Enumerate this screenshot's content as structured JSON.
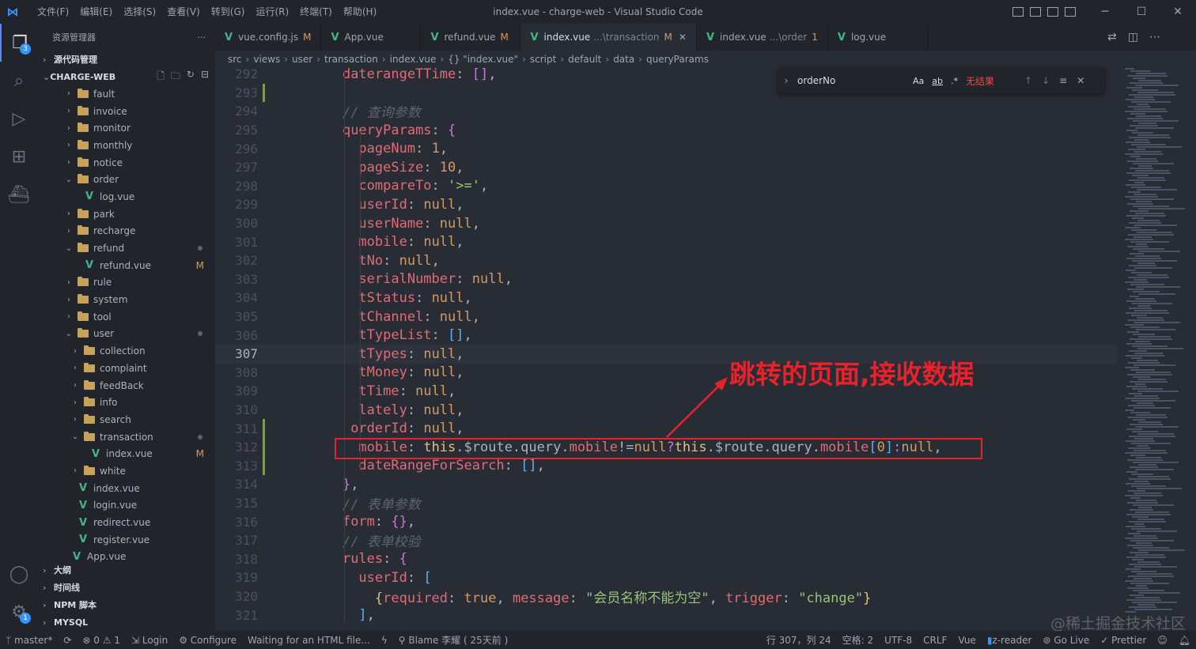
{
  "window": {
    "title": "index.vue - charge-web - Visual Studio Code",
    "menu": [
      "文件(F)",
      "编辑(E)",
      "选择(S)",
      "查看(V)",
      "转到(G)",
      "运行(R)",
      "终端(T)",
      "帮助(H)"
    ],
    "controls": {
      "minimize": "─",
      "maximize": "☐",
      "close": "✕"
    }
  },
  "activity": {
    "explorer_badge": "3",
    "settings_badge": "1"
  },
  "sidebar": {
    "header": "资源管理器",
    "header_more": "···",
    "scm_section": "源代码管理",
    "project": "CHARGE-WEB",
    "tree": [
      {
        "label": "fault",
        "type": "folder",
        "depth": 1,
        "state": "collapsed"
      },
      {
        "label": "invoice",
        "type": "folder",
        "depth": 1,
        "state": "collapsed"
      },
      {
        "label": "monitor",
        "type": "folder",
        "depth": 1,
        "state": "collapsed"
      },
      {
        "label": "monthly",
        "type": "folder",
        "depth": 1,
        "state": "collapsed"
      },
      {
        "label": "notice",
        "type": "folder",
        "depth": 1,
        "state": "collapsed"
      },
      {
        "label": "order",
        "type": "folder",
        "depth": 1,
        "state": "expanded"
      },
      {
        "label": "log.vue",
        "type": "vue",
        "depth": 2
      },
      {
        "label": "park",
        "type": "folder",
        "depth": 1,
        "state": "collapsed"
      },
      {
        "label": "recharge",
        "type": "folder",
        "depth": 1,
        "state": "collapsed"
      },
      {
        "label": "refund",
        "type": "folder",
        "depth": 1,
        "state": "expanded",
        "dot": true
      },
      {
        "label": "refund.vue",
        "type": "vue",
        "depth": 2,
        "status": "M"
      },
      {
        "label": "rule",
        "type": "folder",
        "depth": 1,
        "state": "collapsed"
      },
      {
        "label": "system",
        "type": "folder",
        "depth": 1,
        "state": "collapsed"
      },
      {
        "label": "tool",
        "type": "folder",
        "depth": 1,
        "state": "collapsed"
      },
      {
        "label": "user",
        "type": "folder",
        "depth": 1,
        "state": "expanded",
        "dot": true
      },
      {
        "label": "collection",
        "type": "folder",
        "depth": 2,
        "state": "collapsed"
      },
      {
        "label": "complaint",
        "type": "folder",
        "depth": 2,
        "state": "collapsed"
      },
      {
        "label": "feedBack",
        "type": "folder",
        "depth": 2,
        "state": "collapsed"
      },
      {
        "label": "info",
        "type": "folder",
        "depth": 2,
        "state": "collapsed"
      },
      {
        "label": "search",
        "type": "folder",
        "depth": 2,
        "state": "collapsed"
      },
      {
        "label": "transaction",
        "type": "folder",
        "depth": 2,
        "state": "expanded",
        "dot": true
      },
      {
        "label": "index.vue",
        "type": "vue",
        "depth": 3,
        "status": "M"
      },
      {
        "label": "white",
        "type": "folder",
        "depth": 2,
        "state": "collapsed"
      },
      {
        "label": "index.vue",
        "type": "vue",
        "depth": 1
      },
      {
        "label": "login.vue",
        "type": "vue",
        "depth": 1
      },
      {
        "label": "redirect.vue",
        "type": "vue",
        "depth": 1
      },
      {
        "label": "register.vue",
        "type": "vue",
        "depth": 1
      },
      {
        "label": "App.vue",
        "type": "vue",
        "depth": 0
      }
    ],
    "bottom_sections": [
      "大纲",
      "时间线",
      "NPM 脚本",
      "MYSQL"
    ]
  },
  "tabs": [
    {
      "name": "vue.config.js",
      "status": "M",
      "icon": "vue-icon"
    },
    {
      "name": "App.vue",
      "status": "",
      "icon": "vue-icon"
    },
    {
      "name": "refund.vue",
      "status": "M",
      "icon": "vue-icon"
    },
    {
      "name": "index.vue",
      "desc": "...\\transaction",
      "status": "M",
      "icon": "vue-icon",
      "active": true,
      "close": "✕"
    },
    {
      "name": "index.vue",
      "desc": "...\\order",
      "status": "1",
      "icon": "vue-icon"
    },
    {
      "name": "log.vue",
      "status": "",
      "icon": "vue-icon"
    }
  ],
  "breadcrumb": [
    "src",
    "views",
    "user",
    "transaction",
    "index.vue",
    "{} \"index.vue\"",
    "script",
    "default",
    "data",
    "queryParams"
  ],
  "find": {
    "value": "orderNo",
    "match_case": "Aa",
    "whole_word": "ab",
    "regex": ".*",
    "result": "无结果"
  },
  "editor": {
    "current_line": 307,
    "lines": [
      {
        "n": 292,
        "tokens": [
          [
            "    ",
            ""
          ],
          [
            "daterangeTTime",
            "prop"
          ],
          [
            ": ",
            "pun"
          ],
          [
            "[]",
            "brk2"
          ],
          [
            ",",
            "pun"
          ]
        ]
      },
      {
        "n": 293,
        "tokens": []
      },
      {
        "n": 294,
        "tokens": [
          [
            "    ",
            ""
          ],
          [
            "// 查询参数",
            "com"
          ]
        ]
      },
      {
        "n": 295,
        "tokens": [
          [
            "    ",
            ""
          ],
          [
            "queryParams",
            "prop"
          ],
          [
            ": ",
            "pun"
          ],
          [
            "{",
            "brk2"
          ]
        ]
      },
      {
        "n": 296,
        "tokens": [
          [
            "      ",
            ""
          ],
          [
            "pageNum",
            "prop"
          ],
          [
            ": ",
            "pun"
          ],
          [
            "1",
            "num"
          ],
          [
            ",",
            "pun"
          ]
        ]
      },
      {
        "n": 297,
        "tokens": [
          [
            "      ",
            ""
          ],
          [
            "pageSize",
            "prop"
          ],
          [
            ": ",
            "pun"
          ],
          [
            "10",
            "num"
          ],
          [
            ",",
            "pun"
          ]
        ]
      },
      {
        "n": 298,
        "tokens": [
          [
            "      ",
            ""
          ],
          [
            "compareTo",
            "prop"
          ],
          [
            ": ",
            "pun"
          ],
          [
            "'>='",
            "str"
          ],
          [
            ",",
            "pun"
          ]
        ]
      },
      {
        "n": 299,
        "tokens": [
          [
            "      ",
            ""
          ],
          [
            "userId",
            "prop"
          ],
          [
            ": ",
            "pun"
          ],
          [
            "null",
            "num"
          ],
          [
            ",",
            "pun"
          ]
        ]
      },
      {
        "n": 300,
        "tokens": [
          [
            "      ",
            ""
          ],
          [
            "userName",
            "prop"
          ],
          [
            ": ",
            "pun"
          ],
          [
            "null",
            "num"
          ],
          [
            ",",
            "pun"
          ]
        ]
      },
      {
        "n": 301,
        "tokens": [
          [
            "      ",
            ""
          ],
          [
            "mobile",
            "prop"
          ],
          [
            ": ",
            "pun"
          ],
          [
            "null",
            "num"
          ],
          [
            ",",
            "pun"
          ]
        ]
      },
      {
        "n": 302,
        "tokens": [
          [
            "      ",
            ""
          ],
          [
            "tNo",
            "prop"
          ],
          [
            ": ",
            "pun"
          ],
          [
            "null",
            "num"
          ],
          [
            ",",
            "pun"
          ]
        ]
      },
      {
        "n": 303,
        "tokens": [
          [
            "      ",
            ""
          ],
          [
            "serialNumber",
            "prop"
          ],
          [
            ": ",
            "pun"
          ],
          [
            "null",
            "num"
          ],
          [
            ",",
            "pun"
          ]
        ]
      },
      {
        "n": 304,
        "tokens": [
          [
            "      ",
            ""
          ],
          [
            "tStatus",
            "prop"
          ],
          [
            ": ",
            "pun"
          ],
          [
            "null",
            "num"
          ],
          [
            ",",
            "pun"
          ]
        ]
      },
      {
        "n": 305,
        "tokens": [
          [
            "      ",
            ""
          ],
          [
            "tChannel",
            "prop"
          ],
          [
            ": ",
            "pun"
          ],
          [
            "null",
            "num"
          ],
          [
            ",",
            "pun"
          ]
        ]
      },
      {
        "n": 306,
        "tokens": [
          [
            "      ",
            ""
          ],
          [
            "tTypeList",
            "prop"
          ],
          [
            ": ",
            "pun"
          ],
          [
            "[]",
            "brk3"
          ],
          [
            ",",
            "pun"
          ]
        ]
      },
      {
        "n": 307,
        "tokens": [
          [
            "      ",
            ""
          ],
          [
            "tTypes",
            "prop"
          ],
          [
            ": ",
            "pun"
          ],
          [
            "null",
            "num"
          ],
          [
            ",",
            "pun"
          ]
        ]
      },
      {
        "n": 308,
        "tokens": [
          [
            "      ",
            ""
          ],
          [
            "tMoney",
            "prop"
          ],
          [
            ": ",
            "pun"
          ],
          [
            "null",
            "num"
          ],
          [
            ",",
            "pun"
          ]
        ]
      },
      {
        "n": 309,
        "tokens": [
          [
            "      ",
            ""
          ],
          [
            "tTime",
            "prop"
          ],
          [
            ": ",
            "pun"
          ],
          [
            "null",
            "num"
          ],
          [
            ",",
            "pun"
          ]
        ]
      },
      {
        "n": 310,
        "tokens": [
          [
            "      ",
            ""
          ],
          [
            "lately",
            "prop"
          ],
          [
            ": ",
            "pun"
          ],
          [
            "null",
            "num"
          ],
          [
            ",",
            "pun"
          ]
        ]
      },
      {
        "n": 311,
        "tokens": [
          [
            "     ",
            ""
          ],
          [
            "orderId",
            "prop"
          ],
          [
            ": ",
            "pun"
          ],
          [
            "null",
            "num"
          ],
          [
            ",",
            "pun"
          ]
        ]
      },
      {
        "n": 312,
        "tokens": [
          [
            "      ",
            ""
          ],
          [
            "mobile",
            "prop"
          ],
          [
            ": ",
            "pun"
          ],
          [
            "this",
            "this"
          ],
          [
            ".$route.query.",
            "pun"
          ],
          [
            "mobile",
            "prop"
          ],
          [
            "!=",
            "pun"
          ],
          [
            "null",
            "num"
          ],
          [
            "?",
            "kw"
          ],
          [
            "this",
            "this"
          ],
          [
            ".$route.query.",
            "pun"
          ],
          [
            "mobile",
            "prop"
          ],
          [
            "[",
            "brk3"
          ],
          [
            "0",
            "num"
          ],
          [
            "]",
            "brk3"
          ],
          [
            ":",
            "kw"
          ],
          [
            "null",
            "num"
          ],
          [
            ",",
            "pun"
          ]
        ]
      },
      {
        "n": 313,
        "tokens": [
          [
            "      ",
            ""
          ],
          [
            "dateRangeForSearch",
            "prop"
          ],
          [
            ": ",
            "pun"
          ],
          [
            "[]",
            "brk3"
          ],
          [
            ",",
            "pun"
          ]
        ]
      },
      {
        "n": 314,
        "tokens": [
          [
            "    ",
            ""
          ],
          [
            "}",
            "brk2"
          ],
          [
            ",",
            "pun"
          ]
        ]
      },
      {
        "n": 315,
        "tokens": [
          [
            "    ",
            ""
          ],
          [
            "// 表单参数",
            "com"
          ]
        ]
      },
      {
        "n": 316,
        "tokens": [
          [
            "    ",
            ""
          ],
          [
            "form",
            "prop"
          ],
          [
            ": ",
            "pun"
          ],
          [
            "{}",
            "brk2"
          ],
          [
            ",",
            "pun"
          ]
        ]
      },
      {
        "n": 317,
        "tokens": [
          [
            "    ",
            ""
          ],
          [
            "// 表单校验",
            "com"
          ]
        ]
      },
      {
        "n": 318,
        "tokens": [
          [
            "    ",
            ""
          ],
          [
            "rules",
            "prop"
          ],
          [
            ": ",
            "pun"
          ],
          [
            "{",
            "brk2"
          ]
        ]
      },
      {
        "n": 319,
        "tokens": [
          [
            "      ",
            ""
          ],
          [
            "userId",
            "prop"
          ],
          [
            ": ",
            "pun"
          ],
          [
            "[",
            "brk3"
          ]
        ]
      },
      {
        "n": 320,
        "tokens": [
          [
            "        ",
            ""
          ],
          [
            "{",
            "brk"
          ],
          [
            "required",
            "prop"
          ],
          [
            ": ",
            "pun"
          ],
          [
            "true",
            "num"
          ],
          [
            ", ",
            "pun"
          ],
          [
            "message",
            "prop"
          ],
          [
            ": ",
            "pun"
          ],
          [
            "\"会员名称不能为空\"",
            "str"
          ],
          [
            ", ",
            "pun"
          ],
          [
            "trigger",
            "prop"
          ],
          [
            ": ",
            "pun"
          ],
          [
            "\"change\"",
            "str"
          ],
          [
            "}",
            "brk"
          ]
        ]
      },
      {
        "n": 321,
        "tokens": [
          [
            "      ",
            ""
          ],
          [
            "]",
            "brk3"
          ],
          [
            ",",
            "pun"
          ]
        ]
      }
    ]
  },
  "annotation": {
    "text": "跳转的页面,接收数据"
  },
  "watermark": "@稀土掘金技术社区",
  "statusbar": {
    "branch": "master*",
    "sync": "⟳",
    "errors": "⊗ 0",
    "warnings": "⚠ 1",
    "login": "Login",
    "configure": "Configure",
    "waiting": "Waiting for an HTML file...",
    "blame": "Blame 李耀 ( 25天前 )",
    "position": "行 307，列 24",
    "spaces": "空格: 2",
    "encoding": "UTF-8",
    "eol": "CRLF",
    "language": "Vue",
    "zreader": "z-reader",
    "golive": "Go Live",
    "prettier": "Prettier"
  },
  "colors": {
    "accent": "#3794ff",
    "annotation": "#e8222a",
    "vue": "#42b883"
  }
}
